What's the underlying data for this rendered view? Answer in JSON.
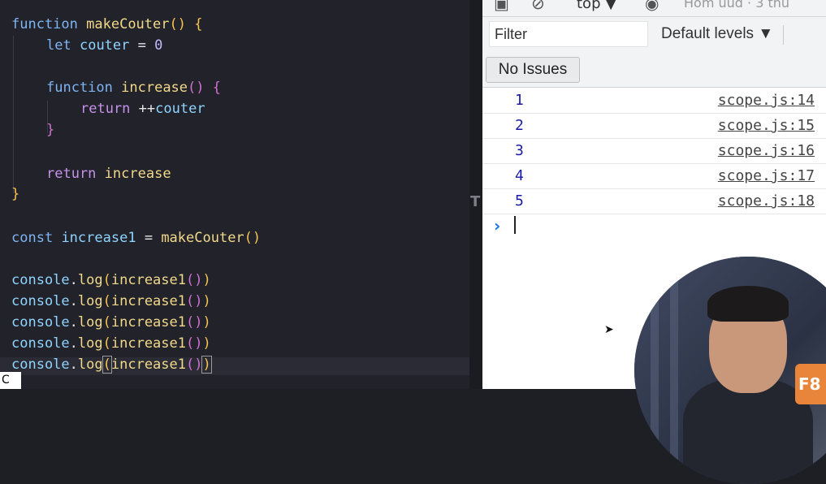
{
  "editor": {
    "lines": {
      "l1": {
        "kw": "function",
        "name": "makeCouter",
        "rest": "()",
        "brace": "{"
      },
      "l2": {
        "kw": "let",
        "name": "couter",
        "eq": "=",
        "val": "0"
      },
      "l4": {
        "kw": "function",
        "name": "increase",
        "rest": "()",
        "brace": "{"
      },
      "l5": {
        "kw": "return",
        "op": "++",
        "name": "couter"
      },
      "l6": {
        "brace": "}"
      },
      "l8": {
        "kw": "return",
        "name": "increase"
      },
      "l9": {
        "brace": "}"
      },
      "l11": {
        "kw": "const",
        "name": "increase1",
        "eq": "=",
        "call": "makeCouter",
        "paren": "()"
      },
      "log": {
        "obj": "console",
        "dot": ".",
        "method": "log",
        "open": "(",
        "arg": "increase1",
        "inner": "()",
        "close": ")"
      }
    },
    "edge_char": "T",
    "corner_char": "C"
  },
  "devtools": {
    "top_label": "top ▼",
    "more_text": "Hom uud  ·  3  thu",
    "filter_placeholder": "Filter",
    "levels_label": "Default levels ▼",
    "issues_label": "No Issues",
    "logs": [
      {
        "value": "1",
        "source": "scope.js:14"
      },
      {
        "value": "2",
        "source": "scope.js:15"
      },
      {
        "value": "3",
        "source": "scope.js:16"
      },
      {
        "value": "4",
        "source": "scope.js:17"
      },
      {
        "value": "5",
        "source": "scope.js:18"
      }
    ],
    "prompt_glyph": "›",
    "logo_text": "F8"
  },
  "colors": {
    "editor_bg": "#21222a",
    "keyword": "#7fb4f2",
    "function_name": "#f2d98a",
    "log_value": "#1a1aa6",
    "prompt": "#1a73e8"
  }
}
